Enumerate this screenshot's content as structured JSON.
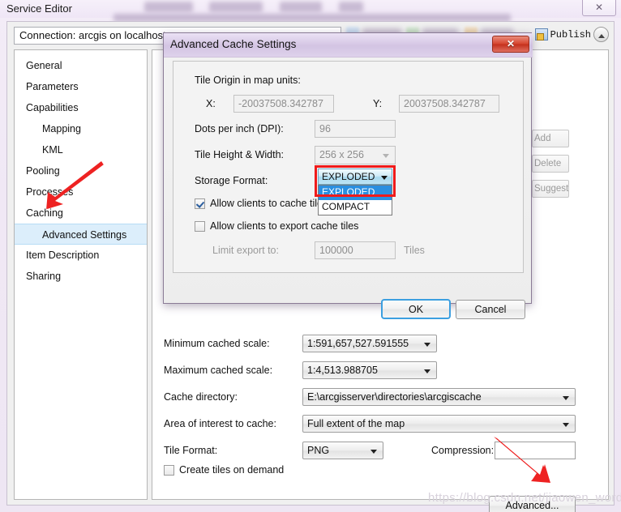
{
  "app": {
    "title": "Service Editor",
    "close_label": "✕",
    "menu_blurred": [
      "Mapping",
      "Customize",
      "Windows",
      "Help"
    ]
  },
  "toolbar": {
    "connection": "Connection: arcgis on localhost",
    "publish_label": "Publish",
    "publish_icon": "publish-icon",
    "collapse_icon": "chevron-up-icon"
  },
  "sidebar": {
    "items": [
      {
        "label": "General",
        "indent": false,
        "selected": false
      },
      {
        "label": "Parameters",
        "indent": false,
        "selected": false
      },
      {
        "label": "Capabilities",
        "indent": false,
        "selected": false
      },
      {
        "label": "Mapping",
        "indent": true,
        "selected": false
      },
      {
        "label": "KML",
        "indent": true,
        "selected": false
      },
      {
        "label": "Pooling",
        "indent": false,
        "selected": false
      },
      {
        "label": "Processes",
        "indent": false,
        "selected": false
      },
      {
        "label": "Caching",
        "indent": false,
        "selected": false
      },
      {
        "label": "Advanced Settings",
        "indent": true,
        "selected": true
      },
      {
        "label": "Item Description",
        "indent": false,
        "selected": false
      },
      {
        "label": "Sharing",
        "indent": false,
        "selected": false
      }
    ]
  },
  "occluded_buttons": [
    {
      "label": "Add"
    },
    {
      "label": "Delete"
    },
    {
      "label": "Suggest..."
    }
  ],
  "cache_panel": {
    "min_scale_label": "Minimum cached scale:",
    "min_scale_value": "1:591,657,527.591555",
    "max_scale_label": "Maximum cached scale:",
    "max_scale_value": "1:4,513.988705",
    "cache_dir_label": "Cache directory:",
    "cache_dir_value": "E:\\arcgisserver\\directories\\arcgiscache",
    "aoi_label": "Area of interest to cache:",
    "aoi_value": "Full extent of the map",
    "tile_format_label": "Tile Format:",
    "tile_format_value": "PNG",
    "compression_label": "Compression:",
    "compression_value": "",
    "create_on_demand_label": "Create tiles on demand",
    "create_on_demand_checked": false,
    "advanced_button": "Advanced..."
  },
  "dialog": {
    "title": "Advanced Cache Settings",
    "close_label": "✕",
    "tile_origin_label": "Tile Origin in map units:",
    "x_label": "X:",
    "x_value": "-20037508.342787",
    "y_label": "Y:",
    "y_value": "20037508.342787",
    "dpi_label": "Dots per inch (DPI):",
    "dpi_value": "96",
    "tile_size_label": "Tile Height & Width:",
    "tile_size_value": "256 x 256",
    "storage_format_label": "Storage Format:",
    "storage_format_value": "EXPLODED",
    "storage_format_options": [
      "EXPLODED",
      "COMPACT"
    ],
    "storage_format_selected_index": 0,
    "cache_local_label": "Allow clients to cache tiles locally",
    "cache_local_checked": true,
    "export_tiles_label": "Allow clients to export cache tiles",
    "export_tiles_checked": false,
    "limit_export_label": "Limit export to:",
    "limit_export_value": "100000",
    "tiles_suffix": "Tiles",
    "ok_label": "OK",
    "cancel_label": "Cancel",
    "highlight_color": "#ef1b1b"
  },
  "annotations": {
    "arrow_color": "#ee2222",
    "arrow_sidebar_target": "Advanced Settings",
    "arrow_advanced_target": "Advanced..."
  },
  "watermark": "https://blog.csdn.net/jiaowen_word"
}
